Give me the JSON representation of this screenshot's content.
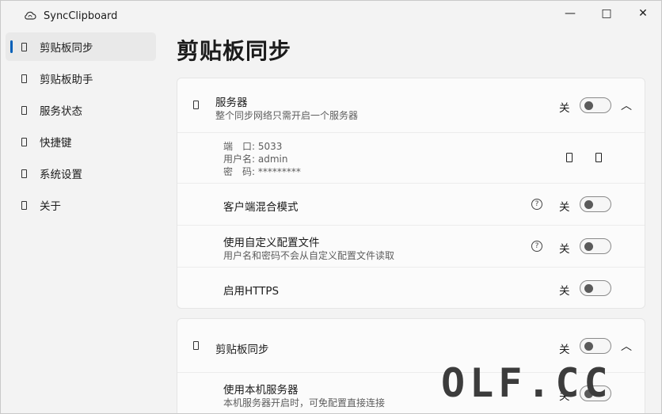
{
  "app": {
    "title": "SyncClipboard",
    "icon": "cloud-sync-icon"
  },
  "window_controls": {
    "minimize": "—",
    "maximize": "□",
    "close": "✕"
  },
  "sidebar": {
    "items": [
      {
        "label": "剪贴板同步",
        "icon": "placeholder-glyph",
        "active": true
      },
      {
        "label": "剪贴板助手",
        "icon": "placeholder-glyph",
        "active": false
      },
      {
        "label": "服务状态",
        "icon": "placeholder-glyph",
        "active": false
      },
      {
        "label": "快捷键",
        "icon": "placeholder-glyph",
        "active": false
      },
      {
        "label": "系统设置",
        "icon": "placeholder-glyph",
        "active": false
      },
      {
        "label": "关于",
        "icon": "placeholder-glyph",
        "active": false
      }
    ]
  },
  "page": {
    "title": "剪贴板同步"
  },
  "server_card": {
    "header": {
      "title": "服务器",
      "desc": "整个同步网络只需开启一个服务器",
      "state": "关",
      "chevron": "︿"
    },
    "info": {
      "port_label": "端　口: ",
      "port": "5033",
      "user_label": "用户名: ",
      "user": "admin",
      "password_label": "密　码: ",
      "password": "*********"
    },
    "rows": [
      {
        "title": "客户端混合模式",
        "desc": "",
        "help": "?",
        "state": "关"
      },
      {
        "title": "使用自定义配置文件",
        "desc": "用户名和密码不会从自定义配置文件读取",
        "help": "?",
        "state": "关"
      },
      {
        "title": "启用HTTPS",
        "desc": "",
        "state": "关"
      }
    ]
  },
  "sync_card": {
    "header": {
      "title": "剪贴板同步",
      "state": "关",
      "chevron": "︿"
    },
    "rows": [
      {
        "title": "使用本机服务器",
        "desc": "本机服务器开启时，可免配置直接连接",
        "state": "关"
      }
    ]
  },
  "watermark": "OLF.CC",
  "colors": {
    "accent": "#005fb8",
    "background": "#f3f3f3",
    "card": "#fbfbfb"
  }
}
